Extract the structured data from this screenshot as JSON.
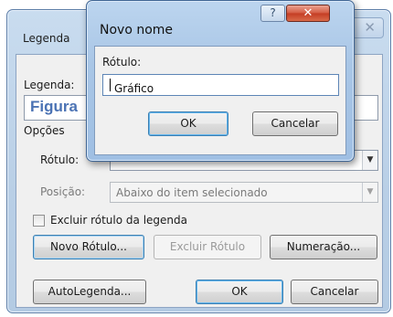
{
  "legenda_dialog": {
    "title": "Legenda",
    "close_glyph": "✕",
    "caption_label": "Legenda:",
    "caption_value": "Figura",
    "options_label": "Opções",
    "label_label": "Rótulo:",
    "position_label": "Posição:",
    "position_value": "Abaixo do item selecionado",
    "exclude_label_checkbox": "Excluir rótulo da legenda",
    "exclude_label_checked": false,
    "buttons": {
      "new_label": "Novo Rótulo...",
      "delete_label": "Excluir Rótulo",
      "numbering": "Numeração...",
      "autocaption": "AutoLegenda...",
      "ok": "OK",
      "cancel": "Cancelar"
    }
  },
  "novo_nome_dialog": {
    "title": "Novo nome",
    "help_glyph": "?",
    "close_glyph": "✕",
    "label_label": "Rótulo:",
    "label_value": "Gráfico",
    "ok": "OK",
    "cancel": "Cancelar"
  },
  "colors": {
    "caption_text": "#4b73b4",
    "close_button": "#c43c23",
    "title_bar": "#a9c6e6"
  }
}
